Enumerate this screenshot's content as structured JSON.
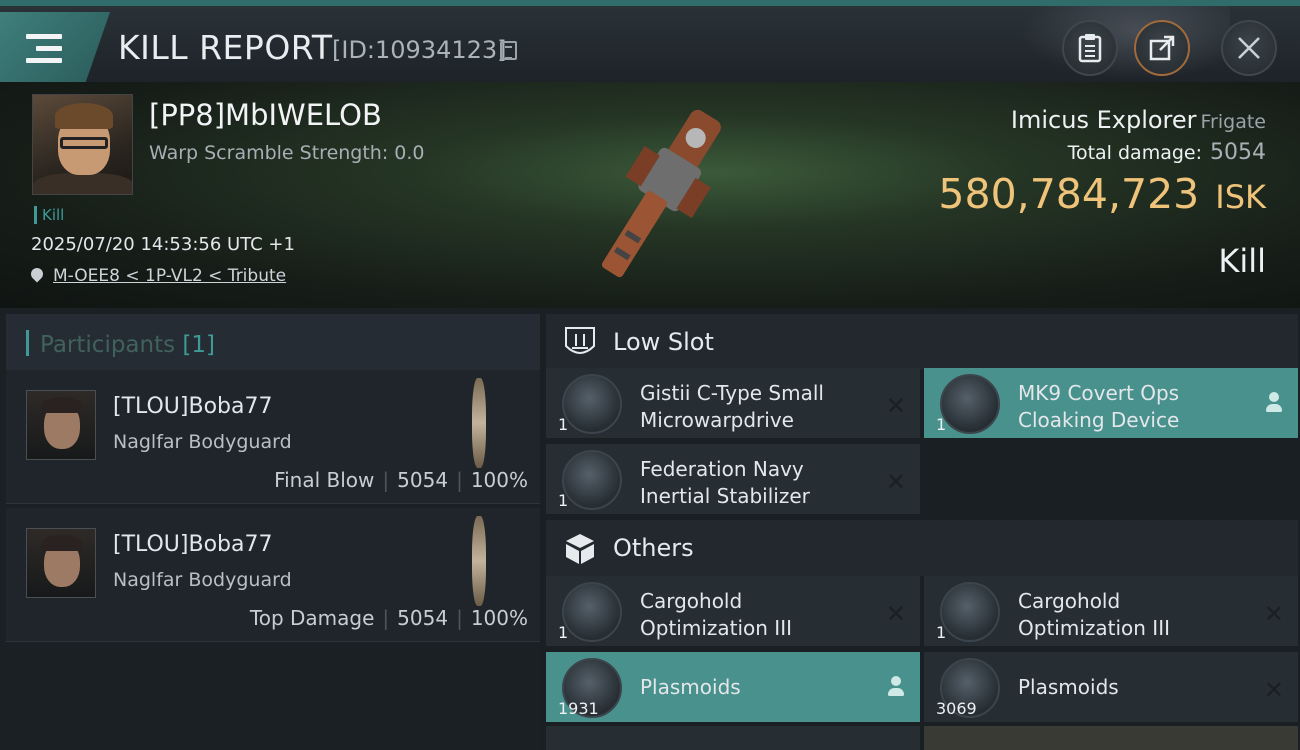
{
  "header": {
    "title": "KILL REPORT",
    "report_id": "[ID:10934123]"
  },
  "victim": {
    "name": "[PP8]MbIWELOB",
    "warp_scramble": "Warp Scramble Strength: 0.0",
    "kill_tag": "Kill",
    "datetime": "2025/07/20 14:53:56 UTC +1",
    "location": "M-OEE8 < 1P-VL2 < Tribute",
    "ship_name": "Imicus Explorer",
    "ship_class": "Frigate",
    "total_damage_label": "Total damage:",
    "total_damage": "5054",
    "isk_value": "580,784,723",
    "isk_unit": "ISK",
    "result": "Kill"
  },
  "participants": {
    "label": "Participants",
    "count": "[1]",
    "rows": [
      {
        "name": "[TLOU]Boba77",
        "ship": "Naglfar Bodyguard",
        "role": "Final Blow",
        "damage": "5054",
        "percent": "100%"
      },
      {
        "name": "[TLOU]Boba77",
        "ship": "Naglfar Bodyguard",
        "role": "Top Damage",
        "damage": "5054",
        "percent": "100%"
      }
    ]
  },
  "low_slot": {
    "title": "Low Slot",
    "items": [
      {
        "line1": "Gistii C-Type Small",
        "line2": "Microwarpdrive",
        "qty": "1"
      },
      {
        "line1": "MK9 Covert Ops",
        "line2": "Cloaking Device",
        "qty": "1"
      },
      {
        "line1": "Federation Navy",
        "line2": "Inertial Stabilizer",
        "qty": "1"
      }
    ]
  },
  "others": {
    "title": "Others",
    "items": [
      {
        "line1": "Cargohold",
        "line2": "Optimization III",
        "qty": "1"
      },
      {
        "line1": "Cargohold",
        "line2": "Optimization III",
        "qty": "1"
      },
      {
        "line1": "Plasmoids",
        "qty": "1931"
      },
      {
        "line1": "Plasmoids",
        "qty": "3069"
      }
    ]
  },
  "colors": {
    "accent": "#3f9a97",
    "isk": "#efc37a",
    "active_slot": "#49918d"
  }
}
